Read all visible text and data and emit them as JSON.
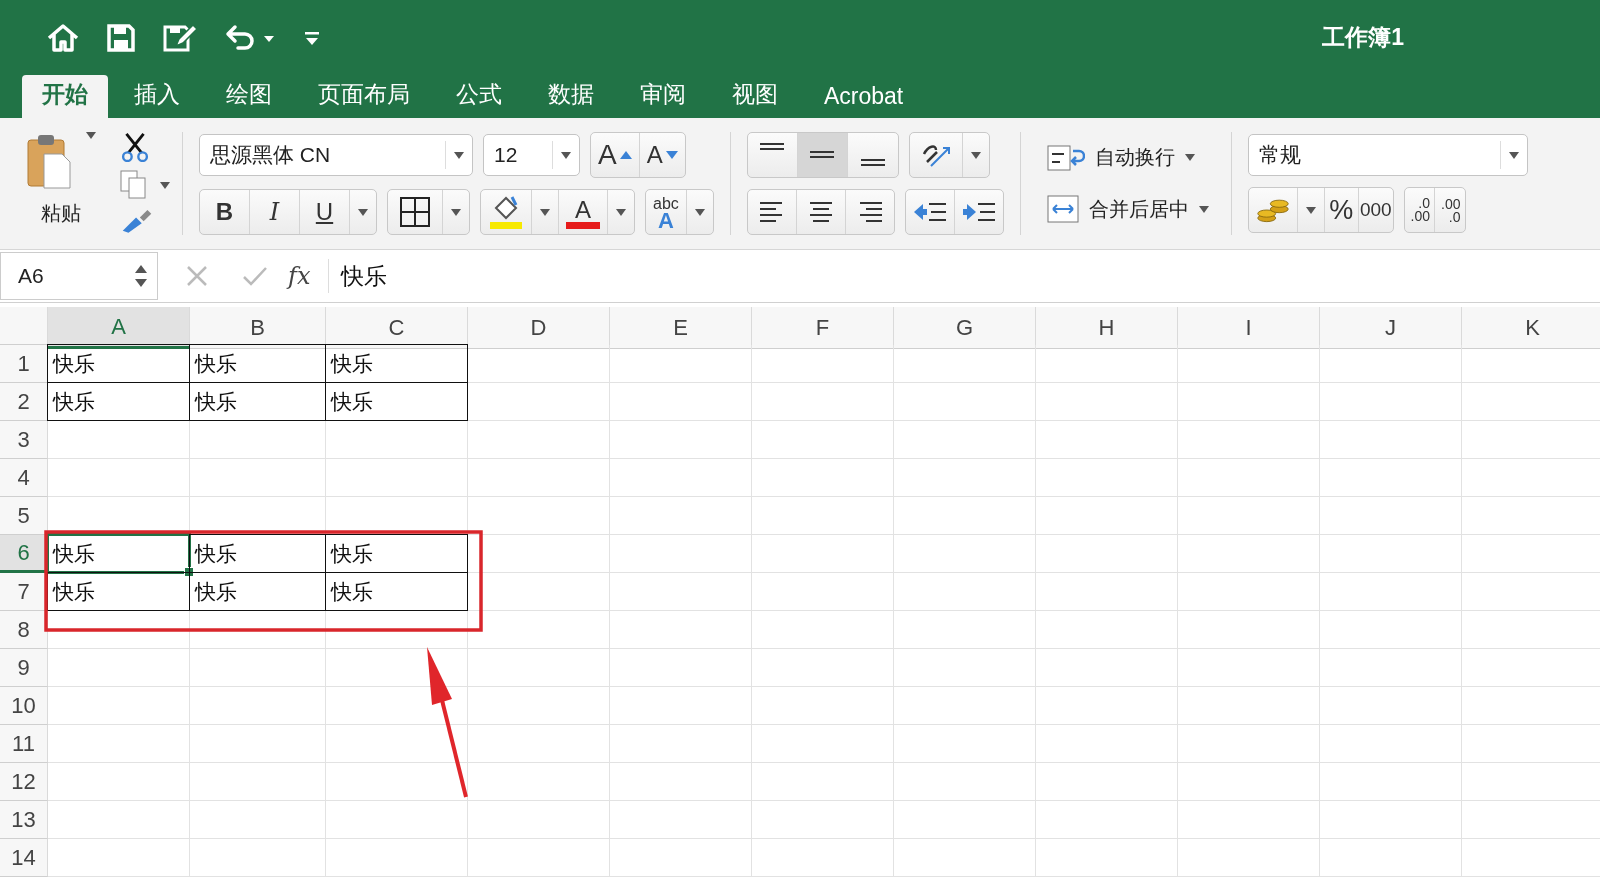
{
  "quick_access": [
    {
      "kind": "home"
    },
    {
      "kind": "save"
    },
    {
      "kind": "edit"
    },
    {
      "kind": "undo"
    },
    {
      "kind": "customize"
    }
  ],
  "window": {
    "title": "工作簿1"
  },
  "tabs": [
    {
      "label": "开始",
      "selected": true
    },
    {
      "label": "插入",
      "selected": false
    },
    {
      "label": "绘图",
      "selected": false
    },
    {
      "label": "页面布局",
      "selected": false
    },
    {
      "label": "公式",
      "selected": false
    },
    {
      "label": "数据",
      "selected": false
    },
    {
      "label": "审阅",
      "selected": false
    },
    {
      "label": "视图",
      "selected": false
    },
    {
      "label": "Acrobat",
      "selected": false
    }
  ],
  "ribbon": {
    "paste_label": "粘贴",
    "font_name": "思源黑体 CN",
    "font_size": "12",
    "grow_font": "A",
    "shrink_font": "A",
    "bold": "B",
    "italic": "I",
    "underline": "U",
    "font_color": "A",
    "text_effects": [
      "abc",
      "A"
    ],
    "vertical_align": [
      {
        "selected": false
      },
      {
        "selected": true
      },
      {
        "selected": false
      }
    ],
    "wrap_text": "自动换行",
    "merge_center": "合并后居中",
    "number_format": "常规",
    "percent": "%",
    "comma_style": "000",
    "increase_decimal": [
      ".0",
      ".00"
    ],
    "decrease_decimal": [
      ".00",
      ".0"
    ]
  },
  "formula_bar": {
    "name_box": "A6",
    "fx": "fx",
    "value": "快乐"
  },
  "sheet": {
    "columns": [
      {
        "label": "A",
        "selected": true
      },
      {
        "label": "B",
        "selected": false
      },
      {
        "label": "C",
        "selected": false
      },
      {
        "label": "D",
        "selected": false
      },
      {
        "label": "E",
        "selected": false
      },
      {
        "label": "F",
        "selected": false
      },
      {
        "label": "G",
        "selected": false
      },
      {
        "label": "H",
        "selected": false
      },
      {
        "label": "I",
        "selected": false
      },
      {
        "label": "J",
        "selected": false
      },
      {
        "label": "K",
        "selected": false
      }
    ],
    "rows": [
      {
        "number": "1",
        "selected": false,
        "cells": [
          {
            "text": "快乐",
            "bordered": true,
            "selected": false
          },
          {
            "text": "快乐",
            "bordered": true,
            "selected": false
          },
          {
            "text": "快乐",
            "bordered": true,
            "selected": false
          }
        ]
      },
      {
        "number": "2",
        "selected": false,
        "cells": [
          {
            "text": "快乐",
            "bordered": true,
            "selected": false
          },
          {
            "text": "快乐",
            "bordered": true,
            "selected": false
          },
          {
            "text": "快乐",
            "bordered": true,
            "selected": false
          }
        ]
      },
      {
        "number": "3",
        "selected": false
      },
      {
        "number": "4",
        "selected": false
      },
      {
        "number": "5",
        "selected": false
      },
      {
        "number": "6",
        "selected": true,
        "cells": [
          {
            "text": "快乐",
            "bordered": true,
            "selected": true
          },
          {
            "text": "快乐",
            "bordered": true,
            "selected": false
          },
          {
            "text": "快乐",
            "bordered": true,
            "selected": false
          }
        ]
      },
      {
        "number": "7",
        "selected": false,
        "cells": [
          {
            "text": "快乐",
            "bordered": true,
            "selected": false
          },
          {
            "text": "快乐",
            "bordered": true,
            "selected": false
          },
          {
            "text": "快乐",
            "bordered": true,
            "selected": false
          }
        ]
      },
      {
        "number": "8",
        "selected": false
      },
      {
        "number": "9",
        "selected": false
      },
      {
        "number": "10",
        "selected": false
      },
      {
        "number": "11",
        "selected": false
      },
      {
        "number": "12",
        "selected": false
      },
      {
        "number": "13",
        "selected": false
      },
      {
        "number": "14",
        "selected": false
      }
    ]
  },
  "annotations": {
    "highlight_frame": true,
    "arrow": true
  }
}
